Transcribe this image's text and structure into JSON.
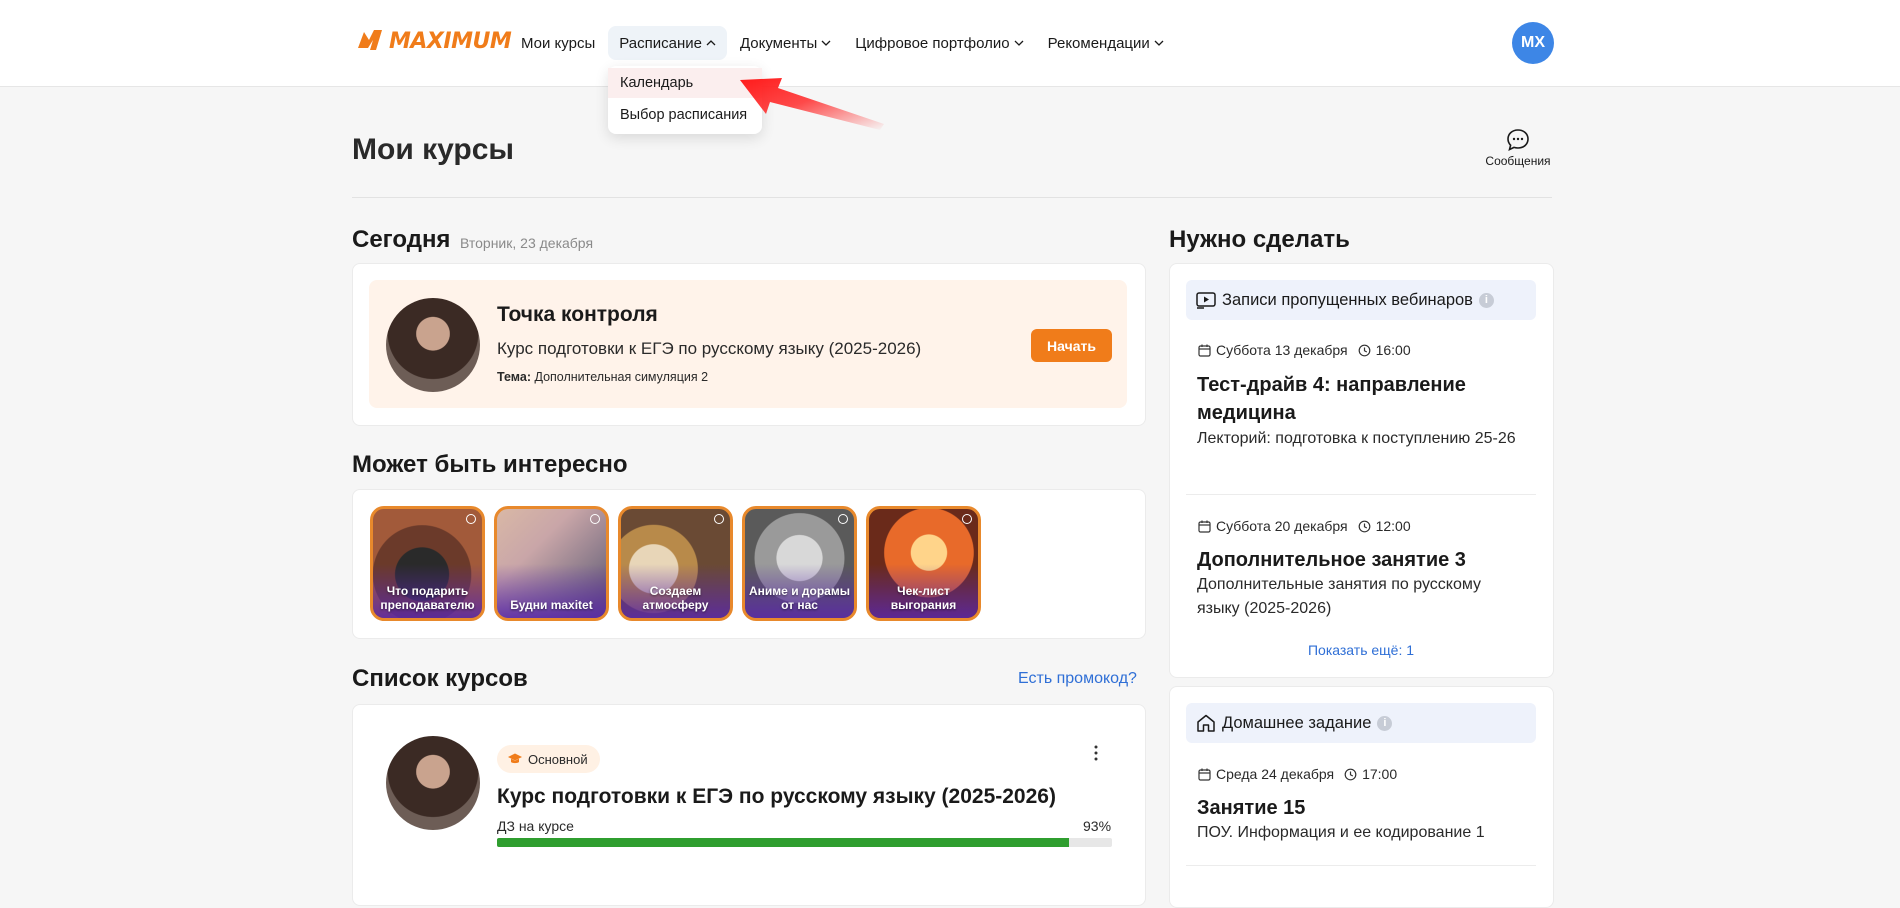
{
  "header": {
    "logo_text": "MAXIMUM",
    "nav": [
      {
        "label": "Мои курсы"
      },
      {
        "label": "Расписание"
      },
      {
        "label": "Документы"
      },
      {
        "label": "Цифровое портфолио"
      },
      {
        "label": "Рекомендации"
      }
    ],
    "avatar_initials": "МХ",
    "dropdown": [
      {
        "label": "Календарь"
      },
      {
        "label": "Выбор расписания"
      }
    ]
  },
  "page": {
    "title": "Мои курсы",
    "messages_label": "Сообщения"
  },
  "today": {
    "heading": "Сегодня",
    "date": "Вторник, 23 декабря",
    "title": "Точка контроля",
    "course": "Курс подготовки к ЕГЭ по русскому языку (2025-2026)",
    "topic_label": "Тема:",
    "topic_value": "Дополнительная симуляция 2",
    "start_button": "Начать"
  },
  "interesting": {
    "heading": "Может быть интересно",
    "stories": [
      {
        "label": "Что подарить преподавателю"
      },
      {
        "label": "Будни maxitet"
      },
      {
        "label": "Создаем атмосферу"
      },
      {
        "label": "Аниме и дорамы от нас"
      },
      {
        "label": "Чек-лист выгорания"
      }
    ]
  },
  "courses": {
    "heading": "Список курсов",
    "promo_link": "Есть промокод?",
    "items": [
      {
        "badge": "Основной",
        "title": "Курс подготовки к ЕГЭ по русскому языку (2025-2026)",
        "hw_label": "ДЗ на курсе",
        "hw_percent_text": "93%",
        "hw_progress": 0.93
      }
    ]
  },
  "todo": {
    "heading": "Нужно сделать",
    "webinars": {
      "label": "Записи пропущенных вебинаров",
      "items": [
        {
          "date": "Суббота 13 декабря",
          "time": "16:00",
          "title": "Тест-драйв 4: направление медицина",
          "subtitle": "Лекторий: подготовка к поступлению 25-26"
        },
        {
          "date": "Суббота 20 декабря",
          "time": "12:00",
          "title": "Дополнительное занятие 3",
          "subtitle": "Дополнительные занятия по русскому языку (2025-2026)"
        }
      ],
      "show_more": "Показать ещё: 1"
    },
    "homework": {
      "label": "Домашнее задание",
      "items": [
        {
          "date": "Среда 24 декабря",
          "time": "17:00",
          "title": "Занятие 15",
          "subtitle": "ПОУ. Информация и ее кодирование 1"
        }
      ]
    }
  },
  "colors": {
    "accent": "#f07c1a",
    "link": "#2f6fd6",
    "avatar": "#3d86e6",
    "progress": "#2f9e2f"
  }
}
